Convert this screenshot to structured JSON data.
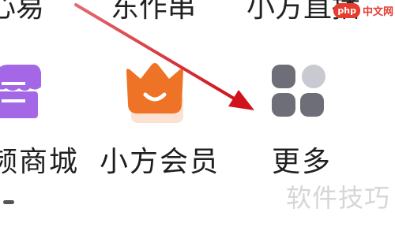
{
  "top_row": {
    "labels": [
      "心易",
      "东作串",
      "小方直播"
    ]
  },
  "watermark": {
    "badge": "php",
    "site": "中文网",
    "bottom": "软件技巧"
  },
  "menu": {
    "items": [
      {
        "label": "频商城",
        "icon": "store-icon"
      },
      {
        "label": "小方会员",
        "icon": "crown-icon"
      },
      {
        "label": "更多",
        "icon": "grid-more-icon"
      }
    ]
  },
  "colors": {
    "store": "#a468e6",
    "crown": "#ee7326",
    "grid_dark": "#6e6e78",
    "grid_light": "#c9c9d1",
    "arrow": "#d1121b"
  }
}
